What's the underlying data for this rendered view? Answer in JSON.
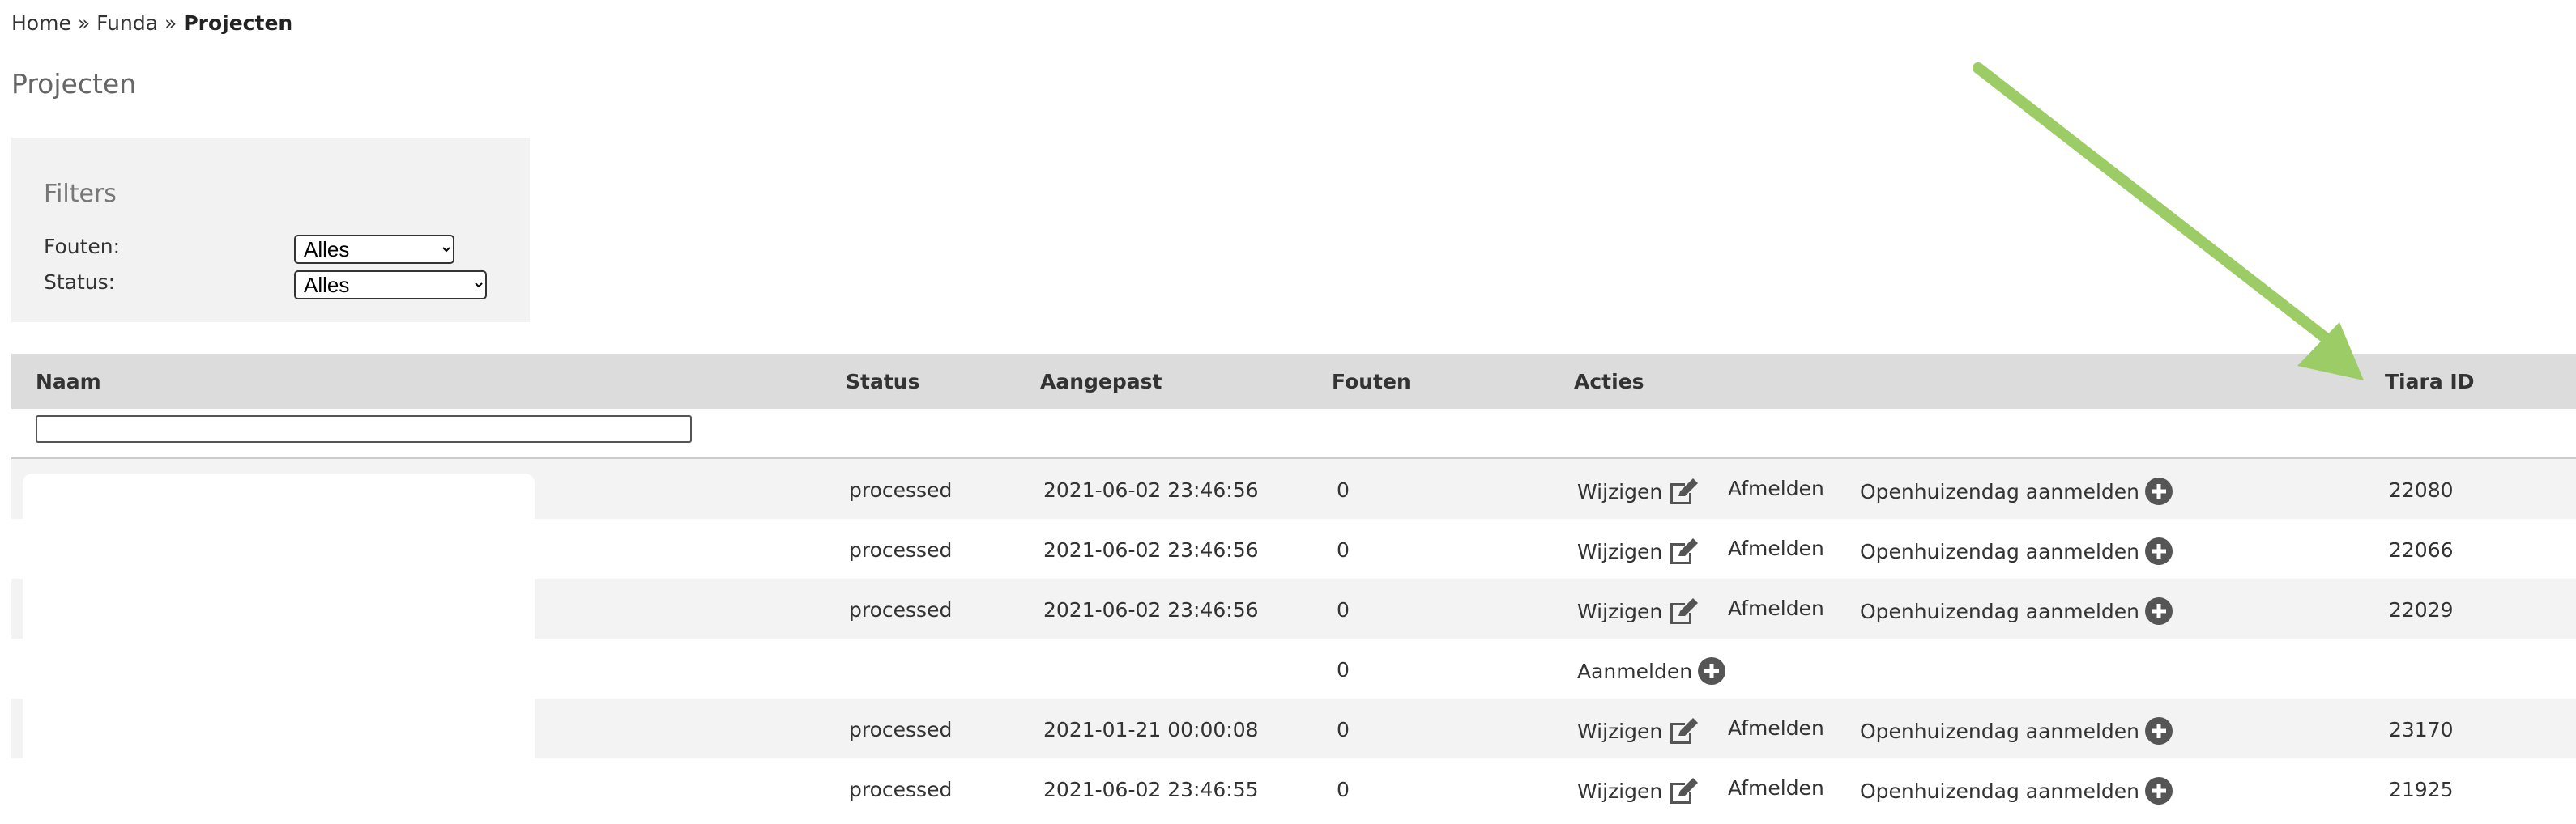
{
  "breadcrumb": {
    "items": [
      "Home",
      "Funda"
    ],
    "separator": "»",
    "current": "Projecten"
  },
  "page": {
    "title": "Projecten"
  },
  "filters": {
    "title": "Filters",
    "fouten_label": "Fouten:",
    "fouten_value": "Alles",
    "status_label": "Status:",
    "status_value": "Alles"
  },
  "table": {
    "headers": {
      "naam": "Naam",
      "status": "Status",
      "aangepast": "Aangepast",
      "fouten": "Fouten",
      "acties": "Acties",
      "tiara_id": "Tiara ID"
    },
    "rows": [
      {
        "status": "processed",
        "aangepast": "2021-06-02 23:46:56",
        "fouten": "0",
        "tiara_id": "22080"
      },
      {
        "status": "processed",
        "aangepast": "2021-06-02 23:46:56",
        "fouten": "0",
        "tiara_id": "22066"
      },
      {
        "status": "processed",
        "aangepast": "2021-06-02 23:46:56",
        "fouten": "0",
        "tiara_id": "22029"
      },
      {
        "status": "",
        "aangepast": "",
        "fouten": "0",
        "tiara_id": ""
      },
      {
        "status": "processed",
        "aangepast": "2021-01-21 00:00:08",
        "fouten": "0",
        "tiara_id": "23170"
      },
      {
        "status": "processed",
        "aangepast": "2021-06-02 23:46:55",
        "fouten": "0",
        "tiara_id": "21925"
      }
    ]
  },
  "actions": {
    "wijzigen": "Wijzigen",
    "afmelden": "Afmelden",
    "openhuizendag": "Openhuizendag aanmelden",
    "aanmelden": "Aanmelden"
  },
  "colors": {
    "arrow": "#9ccc65",
    "header_bg": "#dcdcdc",
    "row_alt_bg": "#f3f3f3",
    "filters_bg": "#f2f2f2",
    "icon": "#555555"
  }
}
